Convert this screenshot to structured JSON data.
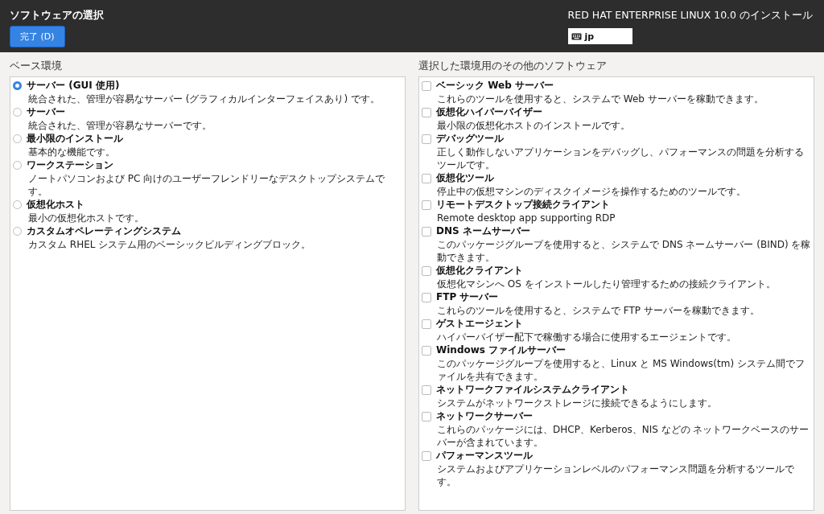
{
  "header": {
    "title": "ソフトウェアの選択",
    "done_button": "完了 (D)",
    "product": "RED HAT ENTERPRISE LINUX 10.0 のインストール",
    "keyboard_layout": "jp"
  },
  "base_environment": {
    "heading": "ベース環境",
    "items": [
      {
        "name": "サーバー (GUI 使用)",
        "description": "統合された、管理が容易なサーバー (グラフィカルインターフェイスあり) です。",
        "selected": true
      },
      {
        "name": "サーバー",
        "description": "統合された、管理が容易なサーバーです。",
        "selected": false
      },
      {
        "name": "最小限のインストール",
        "description": "基本的な機能です。",
        "selected": false
      },
      {
        "name": "ワークステーション",
        "description": "ノートパソコンおよび PC 向けのユーザーフレンドリーなデスクトップシステムです。",
        "selected": false
      },
      {
        "name": "仮想化ホスト",
        "description": "最小の仮想化ホストです。",
        "selected": false
      },
      {
        "name": "カスタムオペレーティングシステム",
        "description": "カスタム RHEL システム用のベーシックビルディングブロック。",
        "selected": false
      }
    ]
  },
  "additional_software": {
    "heading": "選択した環境用のその他のソフトウェア",
    "items": [
      {
        "name": "ベーシック Web サーバー",
        "description": "これらのツールを使用すると、システムで Web サーバーを稼動できます。",
        "checked": false
      },
      {
        "name": "仮想化ハイパーバイザー",
        "description": "最小限の仮想化ホストのインストールです。",
        "checked": false
      },
      {
        "name": "デバッグツール",
        "description": "正しく動作しないアプリケーションをデバッグし、パフォーマンスの問題を分析するツールです。",
        "checked": false
      },
      {
        "name": "仮想化ツール",
        "description": "停止中の仮想マシンのディスクイメージを操作するためのツールです。",
        "checked": false
      },
      {
        "name": "リモートデスクトップ接続クライアント",
        "description": "Remote desktop app supporting RDP",
        "checked": false
      },
      {
        "name": "DNS ネームサーバー",
        "description": "このパッケージグループを使用すると、システムで DNS ネームサーバー (BIND) を稼動できます。",
        "checked": false
      },
      {
        "name": "仮想化クライアント",
        "description": "仮想化マシンへ OS をインストールしたり管理するための接続クライアント。",
        "checked": false
      },
      {
        "name": "FTP サーバー",
        "description": "これらのツールを使用すると、システムで FTP サーバーを稼動できます。",
        "checked": false
      },
      {
        "name": "ゲストエージェント",
        "description": "ハイパーバイザー配下で稼働する場合に使用するエージェントです。",
        "checked": false
      },
      {
        "name": "Windows ファイルサーバー",
        "description": "このパッケージグループを使用すると、Linux と MS Windows(tm) システム間でファイルを共有できます。",
        "checked": false
      },
      {
        "name": "ネットワークファイルシステムクライアント",
        "description": "システムがネットワークストレージに接続できるようにします。",
        "checked": false
      },
      {
        "name": "ネットワークサーバー",
        "description": "これらのパッケージには、DHCP、Kerberos、NIS などの ネットワークベースのサーバーが含まれています。",
        "checked": false
      },
      {
        "name": "パフォーマンスツール",
        "description": "システムおよびアプリケーションレベルのパフォーマンス問題を分析するツールです。",
        "checked": false
      }
    ]
  }
}
